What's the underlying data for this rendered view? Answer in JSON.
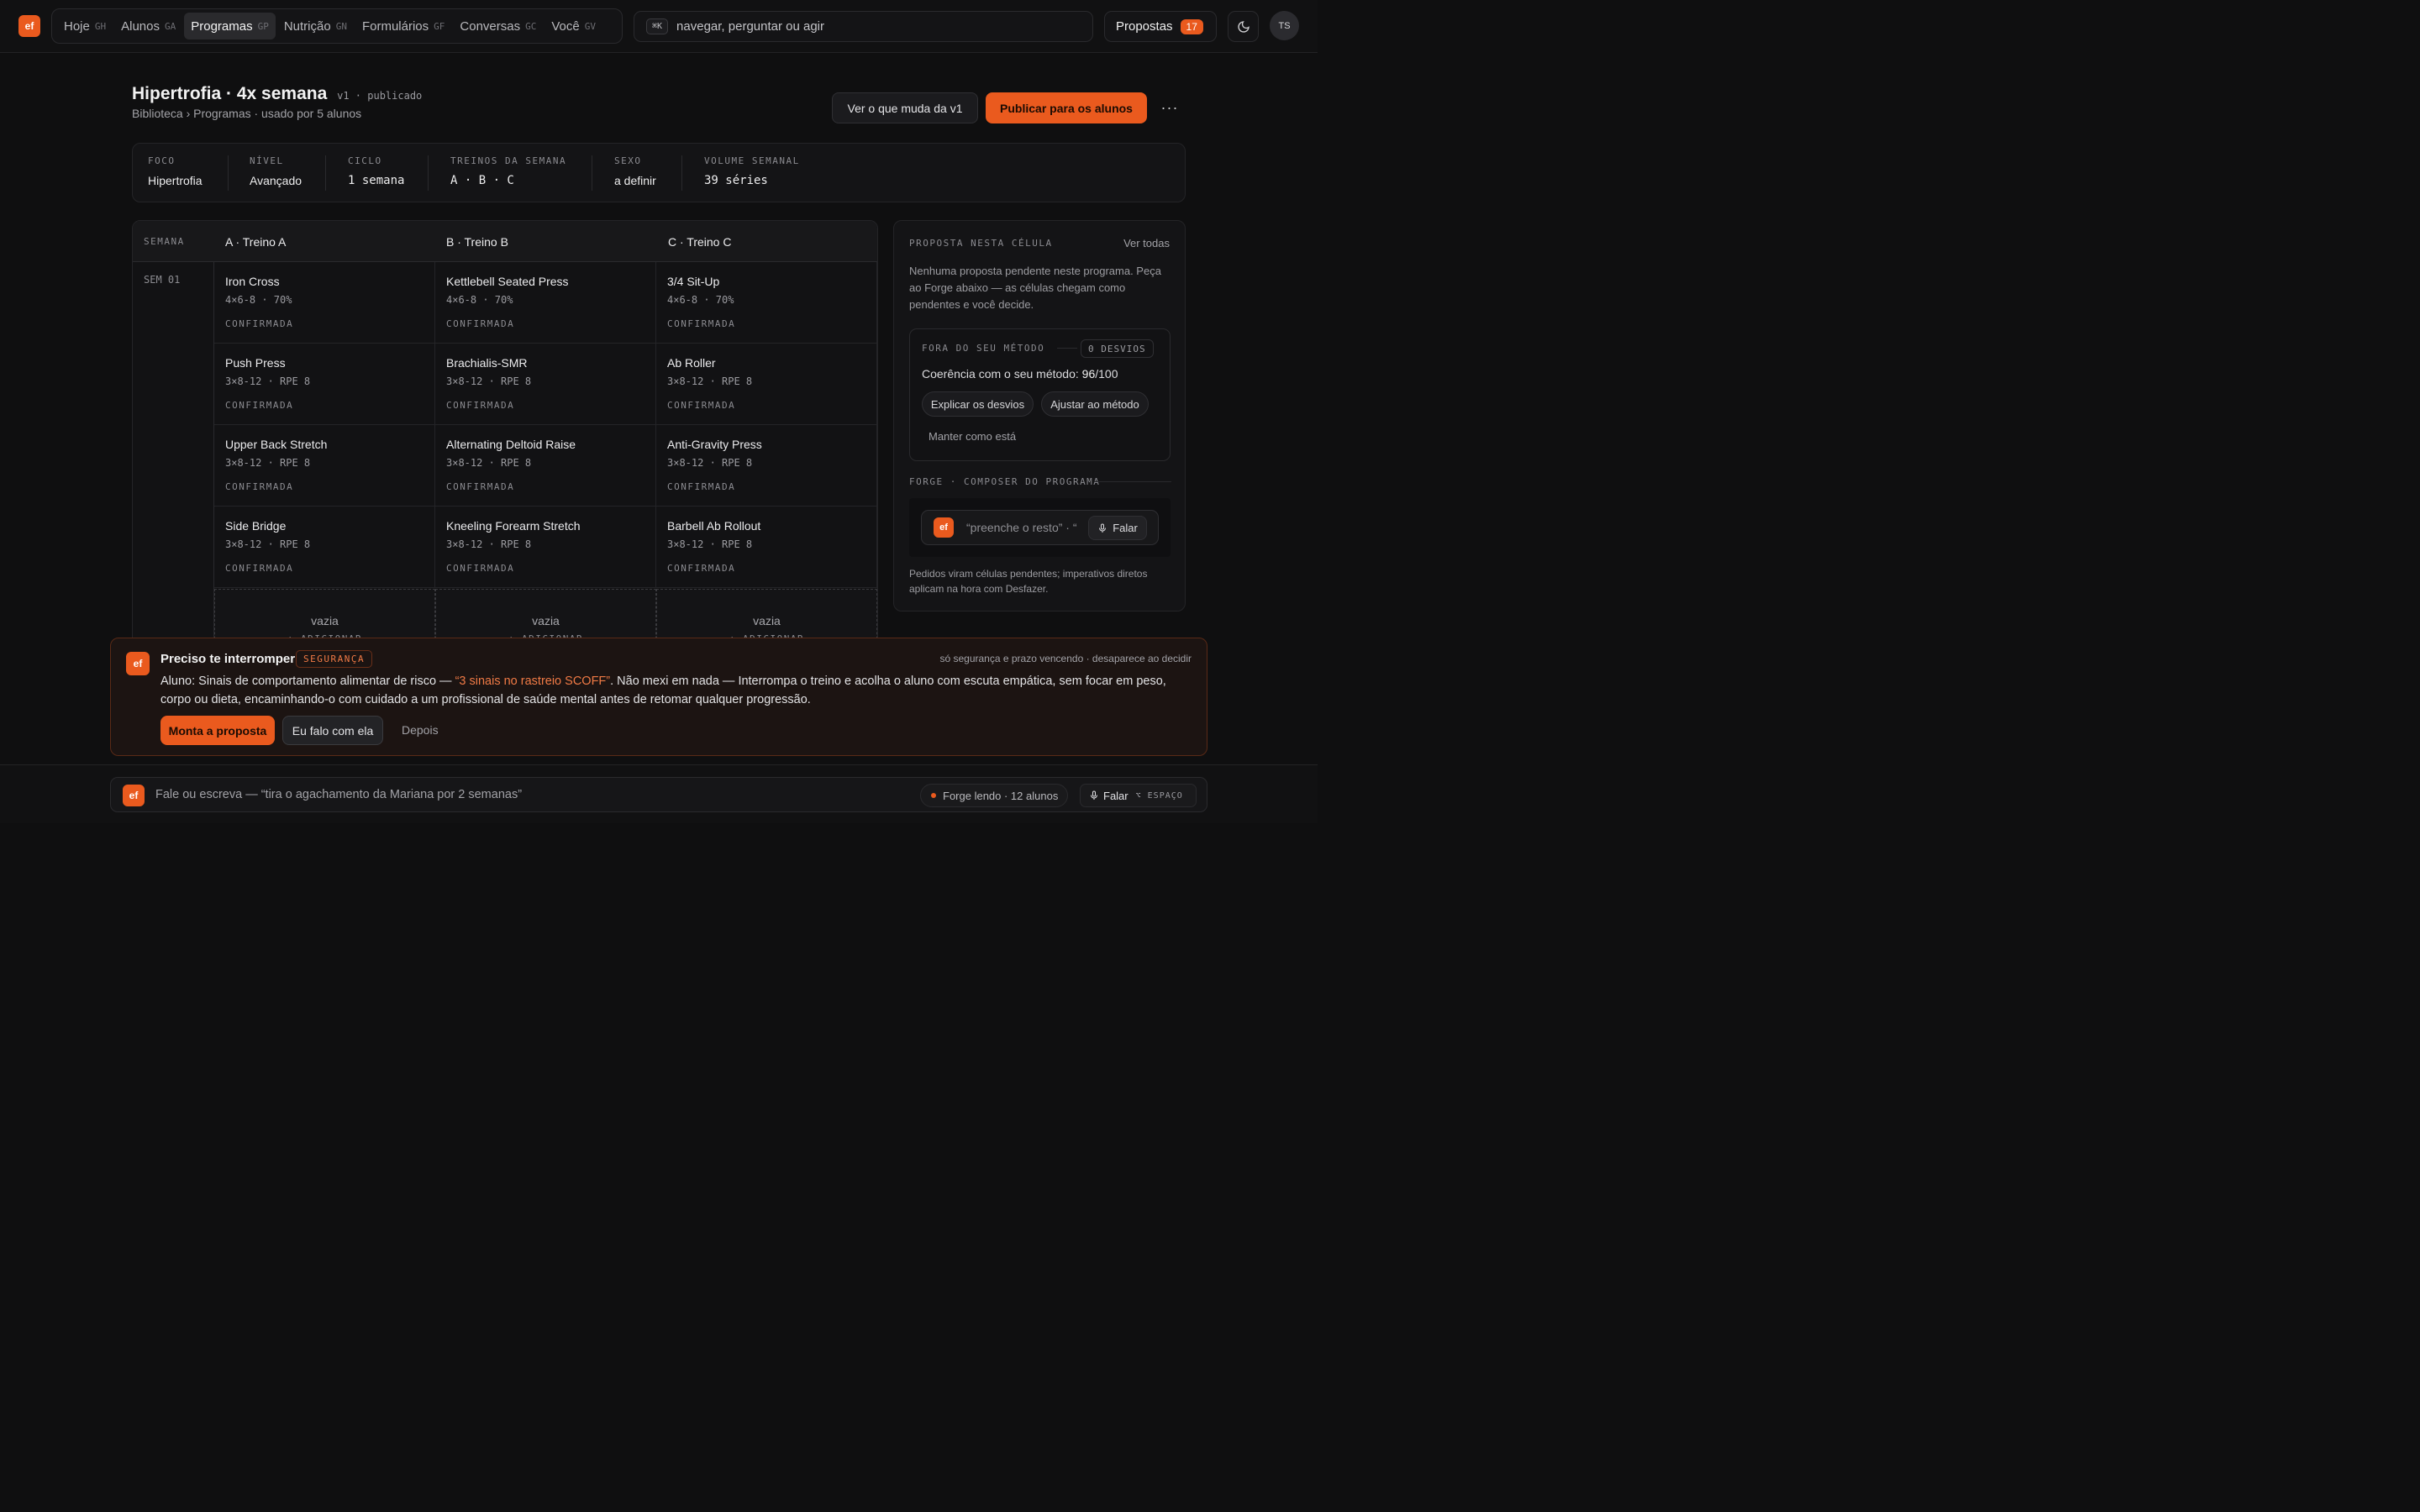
{
  "app": {
    "logo": "ef"
  },
  "nav": [
    {
      "label": "Hoje",
      "kbd": "GH",
      "active": false
    },
    {
      "label": "Alunos",
      "kbd": "GA",
      "active": false
    },
    {
      "label": "Programas",
      "kbd": "GP",
      "active": true
    },
    {
      "label": "Nutrição",
      "kbd": "GN",
      "active": false
    },
    {
      "label": "Formulários",
      "kbd": "GF",
      "active": false
    },
    {
      "label": "Conversas",
      "kbd": "GC",
      "active": false
    },
    {
      "label": "Você",
      "kbd": "GV",
      "active": false
    }
  ],
  "command": {
    "kbd": "⌘K",
    "placeholder": "navegar, perguntar ou agir"
  },
  "proposals": {
    "label": "Propostas",
    "count": "17"
  },
  "user": {
    "initials": "TS"
  },
  "page": {
    "title": "Hipertrofia · 4x semana",
    "version": "v1",
    "status": "publicado",
    "breadcrumb": "Biblioteca › Programas · usado por 5 alunos",
    "diff_button": "Ver o que muda da v1",
    "publish_button": "Publicar para os alunos",
    "more": "···"
  },
  "stats": [
    {
      "label": "FOCO",
      "value": "Hipertrofia",
      "mono": false
    },
    {
      "label": "NÍVEL",
      "value": "Avançado",
      "mono": false
    },
    {
      "label": "CICLO",
      "value": "1 semana",
      "mono": true
    },
    {
      "label": "TREINOS DA SEMANA",
      "value": "A · B · C",
      "mono": true
    },
    {
      "label": "SEXO",
      "value": "a definir",
      "mono": false
    },
    {
      "label": "VOLUME SEMANAL",
      "value": "39 séries",
      "mono": true
    }
  ],
  "grid": {
    "week_header": "SEMANA",
    "columns": [
      "A · Treino A",
      "B · Treino B",
      "C · Treino C"
    ],
    "week_label": "SEM 01",
    "rows": [
      [
        {
          "exercise": "Iron Cross",
          "prescription": "4×6-8 · 70%",
          "status": "CONFIRMADA"
        },
        {
          "exercise": "Kettlebell Seated Press",
          "prescription": "4×6-8 · 70%",
          "status": "CONFIRMADA"
        },
        {
          "exercise": "3/4 Sit-Up",
          "prescription": "4×6-8 · 70%",
          "status": "CONFIRMADA"
        }
      ],
      [
        {
          "exercise": "Push Press",
          "prescription": "3×8-12 · RPE 8",
          "status": "CONFIRMADA"
        },
        {
          "exercise": "Brachialis-SMR",
          "prescription": "3×8-12 · RPE 8",
          "status": "CONFIRMADA"
        },
        {
          "exercise": "Ab Roller",
          "prescription": "3×8-12 · RPE 8",
          "status": "CONFIRMADA"
        }
      ],
      [
        {
          "exercise": "Upper Back Stretch",
          "prescription": "3×8-12 · RPE 8",
          "status": "CONFIRMADA"
        },
        {
          "exercise": "Alternating Deltoid Raise",
          "prescription": "3×8-12 · RPE 8",
          "status": "CONFIRMADA"
        },
        {
          "exercise": "Anti-Gravity Press",
          "prescription": "3×8-12 · RPE 8",
          "status": "CONFIRMADA"
        }
      ],
      [
        {
          "exercise": "Side Bridge",
          "prescription": "3×8-12 · RPE 8",
          "status": "CONFIRMADA"
        },
        {
          "exercise": "Kneeling Forearm Stretch",
          "prescription": "3×8-12 · RPE 8",
          "status": "CONFIRMADA"
        },
        {
          "exercise": "Barbell Ab Rollout",
          "prescription": "3×8-12 · RPE 8",
          "status": "CONFIRMADA"
        }
      ]
    ],
    "empty": {
      "label": "vazia",
      "add": "+ ADICIONAR"
    }
  },
  "side": {
    "heading": "PROPOSTA NESTA CÉLULA",
    "see_all": "Ver todas",
    "text": "Nenhuma proposta pendente neste programa. Peça ao Forge abaixo — as células chegam como pendentes e você decide.",
    "method_heading": "FORA DO SEU MÉTODO",
    "deviations": "0 DESVIOS",
    "coherence_label": "Coerência com o seu método:",
    "coherence_score": "96",
    "coherence_total": "/100",
    "explain": "Explicar os desvios",
    "adjust": "Ajustar ao método",
    "keep": "Manter como está",
    "composer_heading": "FORGE · COMPOSER DO PROGRAMA",
    "composer_placeholder": "“preenche o resto” · “",
    "speak": "Falar",
    "footnote": "Pedidos viram células pendentes; imperativos diretos aplicam na hora com Desfazer."
  },
  "alert": {
    "title": "Preciso te interromper",
    "tag": "SEGURANÇA",
    "meta": "só segurança e prazo vencendo · desaparece ao decidir",
    "msg_pre": "Aluno: Sinais de comportamento alimentar de risco — ",
    "msg_hl": "“3 sinais no rastreio SCOFF”",
    "msg_post": ". Não mexi em nada — Interrompa o treino e acolha o aluno com escuta empática, sem focar em peso, corpo ou dieta, encaminhando-o com cuidado a um profissional de saúde mental antes de retomar qualquer progressão.",
    "primary": "Monta a proposta",
    "secondary": "Eu falo com ela",
    "later": "Depois"
  },
  "bottom": {
    "placeholder": "Fale ou escreva — “tira o agachamento da Mariana por 2 semanas”",
    "forge_status": "Forge lendo · 12 alunos",
    "speak": "Falar",
    "speak_kbd": "⌥ ESPAÇO"
  },
  "colors": {
    "accent": "#ea5a1e",
    "background": "#0f0f10"
  }
}
